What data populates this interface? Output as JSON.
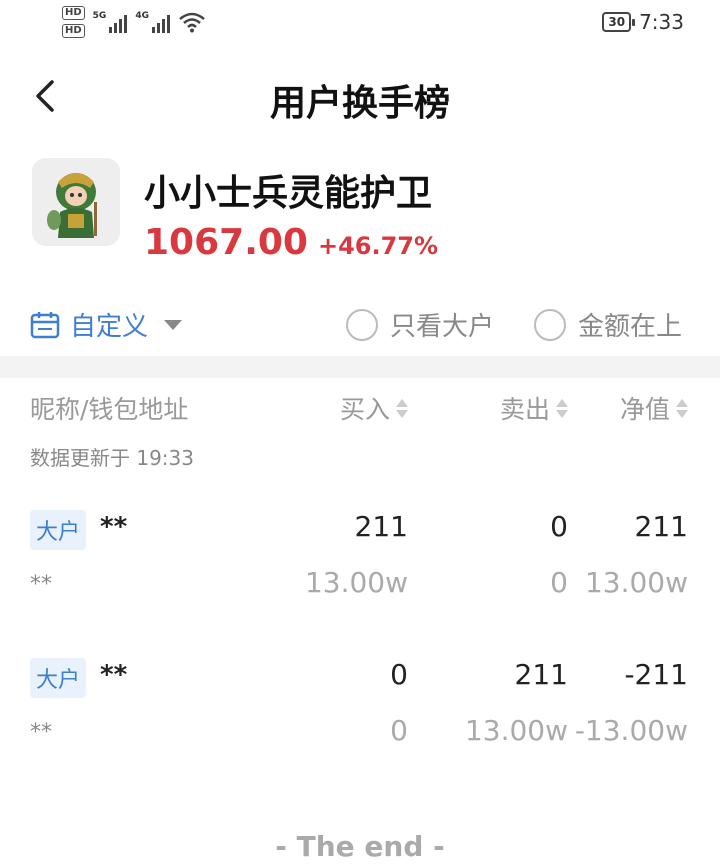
{
  "status_bar": {
    "hd1": "HD",
    "hd2": "HD",
    "net1": "5G",
    "net2": "4G",
    "battery": "30",
    "time": "7:33"
  },
  "nav": {
    "title": "用户换手榜"
  },
  "product": {
    "name": "小小士兵灵能护卫",
    "price": "1067.00",
    "change": "+46.77%"
  },
  "filters": {
    "date_label": "自定义",
    "only_big": "只看大户",
    "amount_first": "金额在上"
  },
  "table": {
    "headers": {
      "name": "昵称/钱包地址",
      "buy": "买入",
      "sell": "卖出",
      "net": "净值"
    },
    "updated": "数据更新于 19:33",
    "rows": [
      {
        "badge": "大户",
        "nick": "**",
        "addr": "**",
        "buy": "211",
        "sell": "0",
        "net": "211",
        "buy_amt": "13.00w",
        "sell_amt": "0",
        "net_amt": "13.00w"
      },
      {
        "badge": "大户",
        "nick": "**",
        "addr": "**",
        "buy": "0",
        "sell": "211",
        "net": "-211",
        "buy_amt": "0",
        "sell_amt": "13.00w",
        "net_amt": "-13.00w"
      }
    ]
  },
  "footer": {
    "end": "- The end -"
  },
  "colors": {
    "accent": "#3f7fd0",
    "price_up": "#d9393e"
  }
}
